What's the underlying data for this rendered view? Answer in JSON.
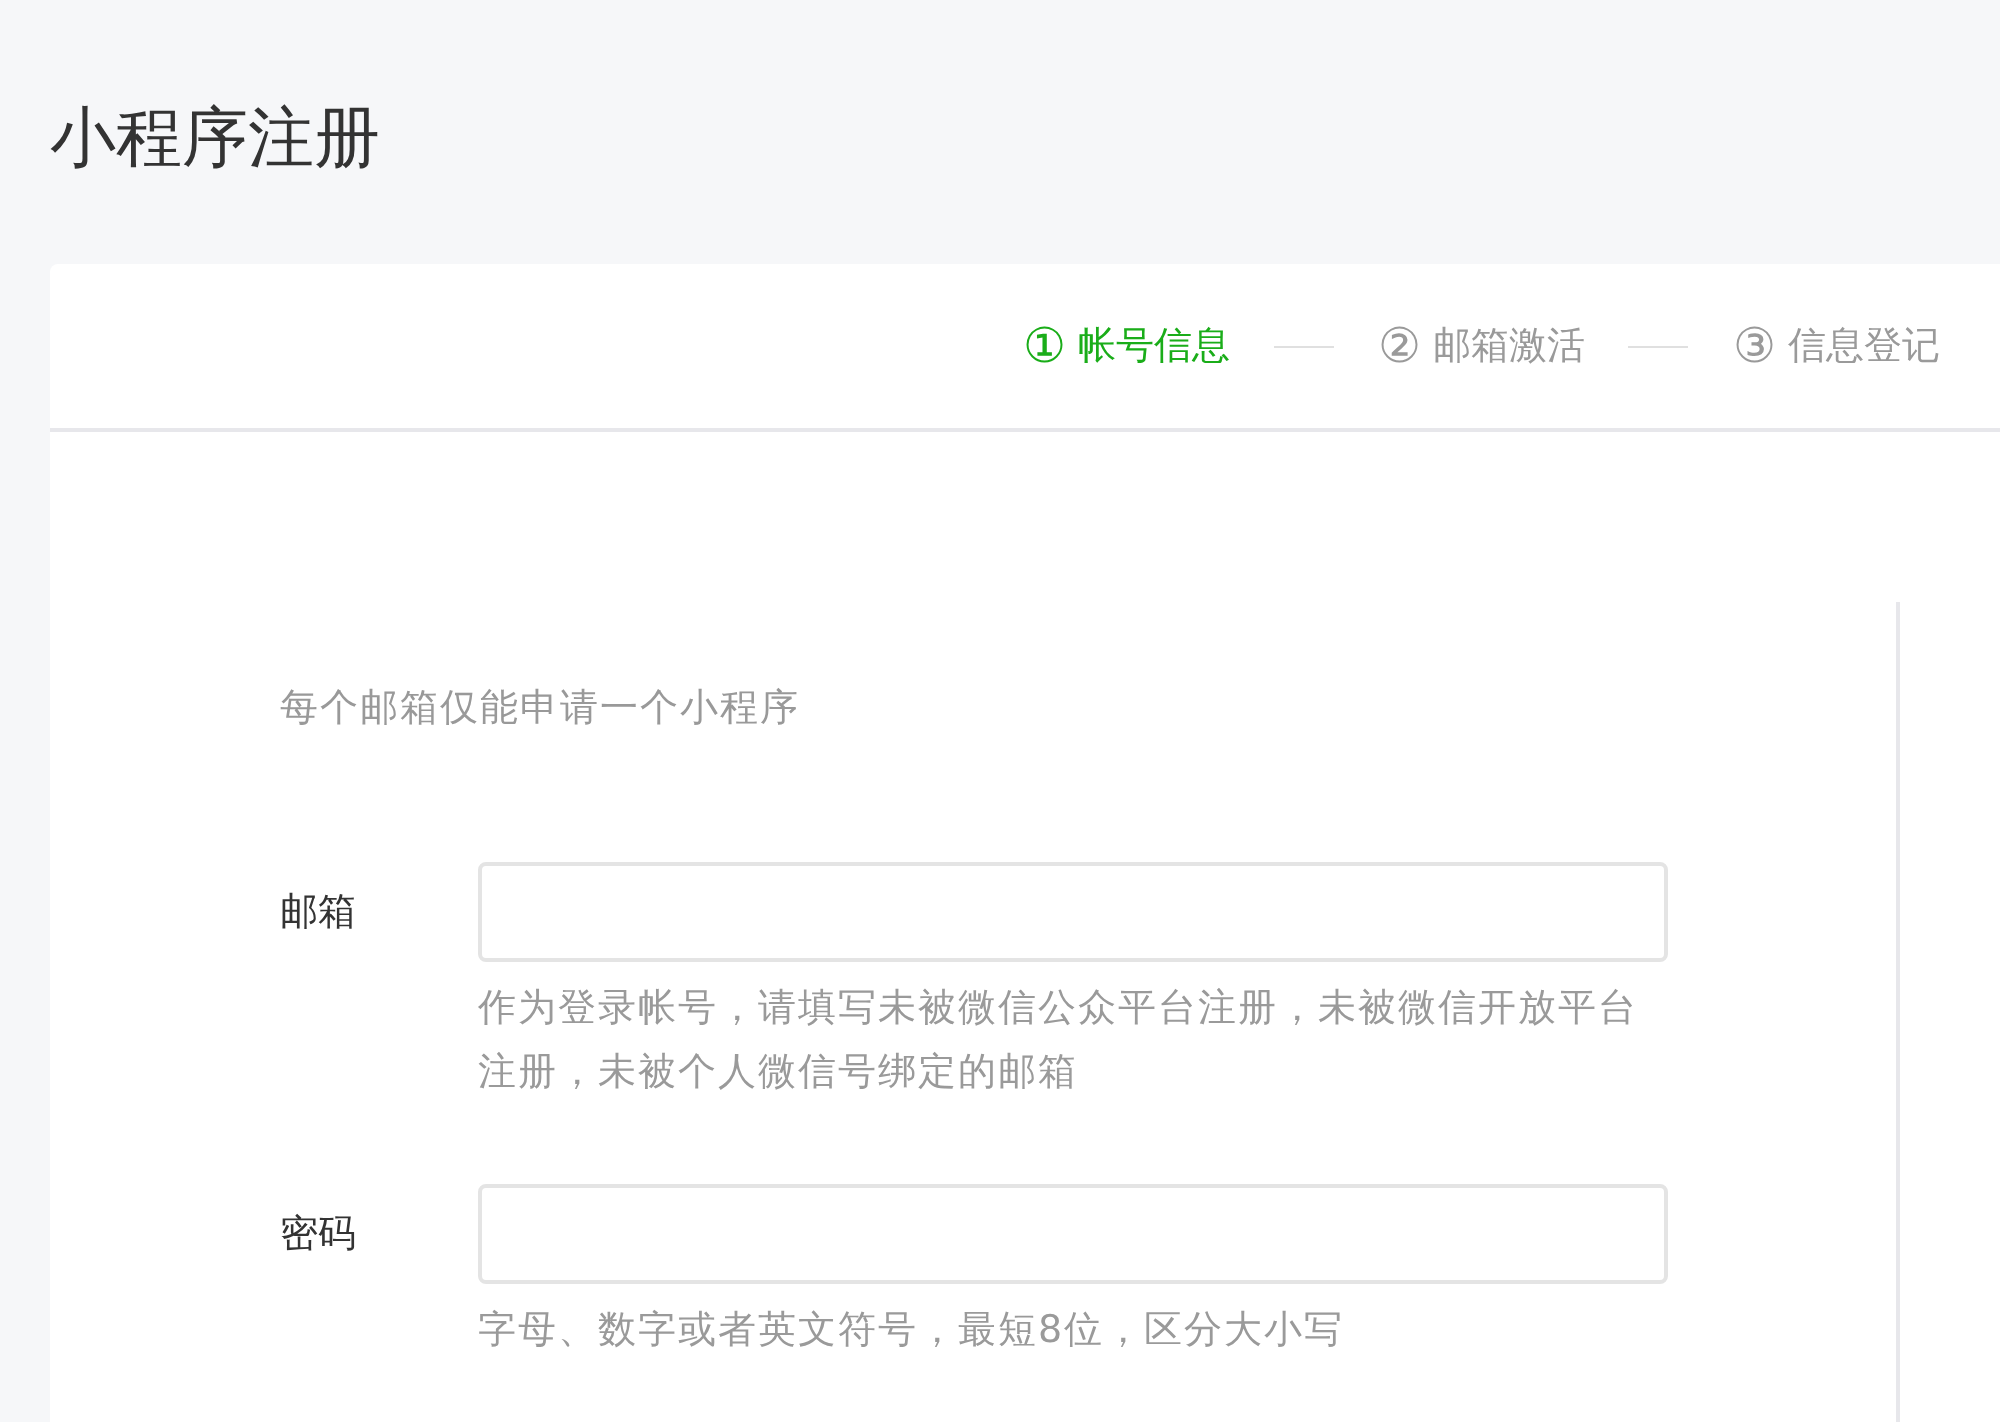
{
  "page_title": "小程序注册",
  "steps": [
    {
      "number": "①",
      "label": "帐号信息",
      "current": true
    },
    {
      "number": "②",
      "label": "邮箱激活",
      "current": false
    },
    {
      "number": "③",
      "label": "信息登记",
      "current": false
    }
  ],
  "notice": "每个邮箱仅能申请一个小程序",
  "fields": [
    {
      "label": "邮箱",
      "hint": "作为登录帐号，请填写未被微信公众平台注册，未被微信开放平台注册，未被个人微信号绑定的邮箱"
    },
    {
      "label": "密码",
      "hint": "字母、数字或者英文符号，最短8位，区分大小写"
    }
  ]
}
